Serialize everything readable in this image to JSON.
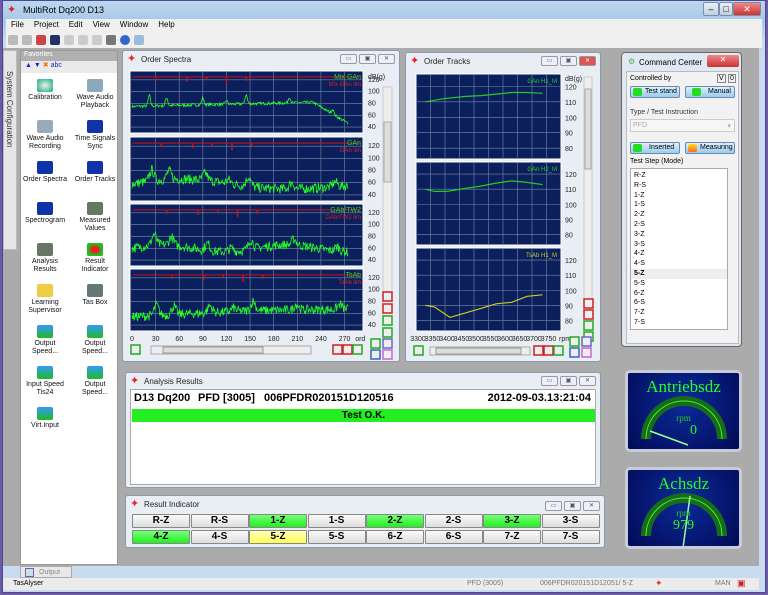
{
  "app": {
    "title": "MultiRot Dq200 D13",
    "menu": [
      "File",
      "Project",
      "Edit",
      "View",
      "Window",
      "Help"
    ]
  },
  "sidetab": "System Configuration",
  "favorites": {
    "title": "Favorites",
    "tool_text": "abc",
    "items": [
      {
        "label": "Calibration",
        "icon": "calibration-icon"
      },
      {
        "label": "Wave Audio Playback",
        "icon": "wave-playback-icon"
      },
      {
        "label": "Wave Audio Recording",
        "icon": "wave-recording-icon"
      },
      {
        "label": "Time Signals Sync",
        "icon": "time-signals-icon"
      },
      {
        "label": "Order Spectra",
        "icon": "spectrum-icon"
      },
      {
        "label": "Order Tracks",
        "icon": "tracks-icon"
      },
      {
        "label": "Spectrogram",
        "icon": "spectrogram-icon"
      },
      {
        "label": "Measured Values",
        "icon": "measured-values-icon"
      },
      {
        "label": "Analysis Results",
        "icon": "analysis-results-icon"
      },
      {
        "label": "Result Indicator",
        "icon": "result-indicator-icon"
      },
      {
        "label": "Learning Supervisor",
        "icon": "folder-icon"
      },
      {
        "label": "Tas Box",
        "icon": "tas-box-icon"
      },
      {
        "label": "Output Speed...",
        "icon": "speedometer-icon"
      },
      {
        "label": "Output Speed...",
        "icon": "speedometer-icon"
      },
      {
        "label": "Input Speed Tis24",
        "icon": "speedometer-icon"
      },
      {
        "label": "Output Speed...",
        "icon": "speedometer-icon"
      },
      {
        "label": "Virt.Input",
        "icon": "speedometer-icon"
      }
    ]
  },
  "order_spectra": {
    "title": "Order Spectra",
    "unit": "dB(g)",
    "x_unit": "ord",
    "x_ticks": [
      "0",
      "30",
      "60",
      "90",
      "120",
      "150",
      "180",
      "210",
      "240",
      "270"
    ],
    "y_ticks": [
      "40",
      "60",
      "80",
      "100",
      "120"
    ],
    "panels": [
      {
        "name": "Mix GAn",
        "limit": "Mix GAn lim"
      },
      {
        "name": "GAn",
        "limit": "GAn lim"
      },
      {
        "name": "GAb/TW2",
        "limit": "GAb/TW2 lim"
      },
      {
        "name": "TsAb",
        "limit": "TsAb lim"
      }
    ]
  },
  "order_tracks": {
    "title": "Order Tracks",
    "unit": "dB(g)",
    "x_unit": "rpm",
    "x_ticks": [
      "3300",
      "3350",
      "3400",
      "3450",
      "3500",
      "3550",
      "3600",
      "3650",
      "3700",
      "3750"
    ],
    "y_ticks": [
      "80",
      "90",
      "100",
      "110",
      "120"
    ],
    "panels": [
      {
        "name": "GAn H1_M",
        "color": "#22cc22",
        "x": [
          3320,
          3380,
          3450,
          3500,
          3550,
          3600,
          3650,
          3700
        ],
        "y": [
          110,
          112,
          113.5,
          114,
          115,
          116,
          116,
          115.5
        ]
      },
      {
        "name": "GAn H2_M",
        "color": "#22cc22",
        "x": [
          3320,
          3350,
          3390,
          3450,
          3500,
          3550,
          3600,
          3650,
          3700
        ],
        "y": [
          110,
          108.5,
          108.5,
          110.5,
          112,
          114,
          115.5,
          114.5,
          113
        ]
      },
      {
        "name": "TsAb H1_M",
        "color": "#cccc22",
        "x": [
          3320,
          3350,
          3400,
          3450,
          3500,
          3550,
          3600,
          3650,
          3700
        ],
        "y": [
          90,
          89,
          82,
          85,
          88,
          91,
          92,
          96,
          97
        ]
      }
    ]
  },
  "command_center": {
    "title": "Command Center",
    "controlled_by": "Controlled by",
    "v": "V",
    "zero": "0",
    "test_stand": "Test stand",
    "manual": "Manual",
    "type_label": "Type / Test Instruction",
    "type_value": "PFD",
    "inserted": "Inserted",
    "measuring": "Measuring",
    "step_label": "Test Step (Mode)",
    "steps": [
      "R-Z",
      "R-S",
      "1-Z",
      "1-S",
      "2-Z",
      "2-S",
      "3-Z",
      "3-S",
      "4-Z",
      "4-S",
      "5-Z",
      "5-S",
      "6-Z",
      "6-S",
      "7-Z",
      "7-S"
    ],
    "selected_step": "5-Z"
  },
  "analysis_results": {
    "title": "Analysis Results",
    "header": [
      "D13 Dq200",
      "PFD [3005]",
      "006PFDR020151D120516",
      "2012-09-03.13:21:04"
    ],
    "result": "Test O.K.",
    "result_color": "#22ee22"
  },
  "result_indicator": {
    "title": "Result Indicator",
    "items": [
      {
        "label": "R-Z",
        "state": "none"
      },
      {
        "label": "R-S",
        "state": "none"
      },
      {
        "label": "1-Z",
        "state": "ok"
      },
      {
        "label": "1-S",
        "state": "none"
      },
      {
        "label": "2-Z",
        "state": "ok"
      },
      {
        "label": "2-S",
        "state": "none"
      },
      {
        "label": "3-Z",
        "state": "ok"
      },
      {
        "label": "3-S",
        "state": "none"
      },
      {
        "label": "4-Z",
        "state": "ok"
      },
      {
        "label": "4-S",
        "state": "none"
      },
      {
        "label": "5-Z",
        "state": "active"
      },
      {
        "label": "5-S",
        "state": "none"
      },
      {
        "label": "6-Z",
        "state": "none"
      },
      {
        "label": "6-S",
        "state": "none"
      },
      {
        "label": "7-Z",
        "state": "none"
      },
      {
        "label": "7-S",
        "state": "none"
      }
    ]
  },
  "gauges": [
    {
      "title": "Antriebsdz",
      "unit": "rpm",
      "value": "0"
    },
    {
      "title": "Achsdz",
      "unit": "rpm",
      "value": "979"
    }
  ],
  "output_tab": "Output",
  "status": {
    "app": "TasAlyser",
    "type": "PFD (3005)",
    "serial": "006PFDR020151D12051/ 5-Z",
    "mode": "MAN"
  }
}
